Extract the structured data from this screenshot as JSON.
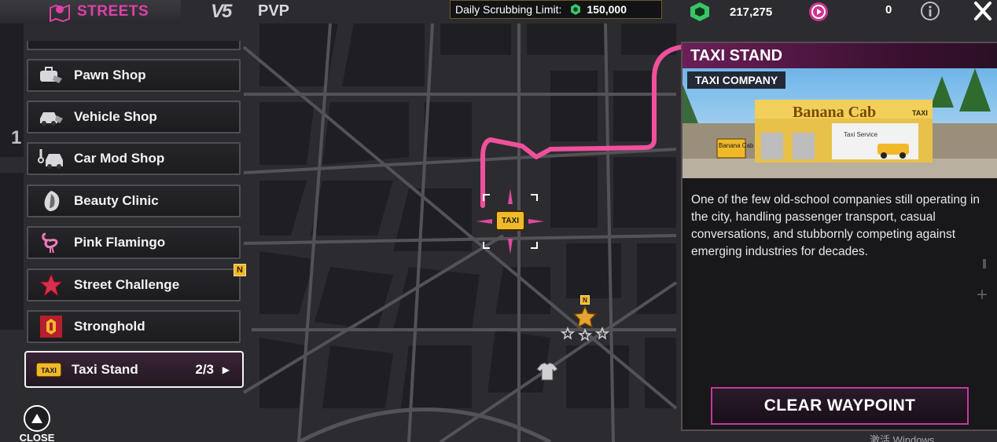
{
  "top_bar": {
    "streets_label": "STREETS",
    "vs_label": "V5",
    "pvp_label": "PVP",
    "limit_label": "Daily Scrubbing Limit:",
    "limit_value": "150,000",
    "currency_main": "217,275",
    "currency_secondary": "0"
  },
  "sidebar": {
    "items": [
      {
        "label": "Pawn Shop",
        "icon": "pawn-shop-icon"
      },
      {
        "label": "Vehicle Shop",
        "icon": "vehicle-shop-icon"
      },
      {
        "label": "Car Mod Shop",
        "icon": "car-mod-icon"
      },
      {
        "label": "Beauty Clinic",
        "icon": "beauty-clinic-icon"
      },
      {
        "label": "Pink Flamingo",
        "icon": "flamingo-icon"
      },
      {
        "label": "Street Challenge",
        "icon": "star-icon",
        "badge": "N"
      },
      {
        "label": "Stronghold",
        "icon": "stronghold-icon"
      },
      {
        "label": "Taxi Stand",
        "icon": "taxi-icon",
        "count": "2/3",
        "active": true
      }
    ],
    "left_marker": "1"
  },
  "close_label": "CLOSE",
  "detail": {
    "title": "TAXI STAND",
    "subtitle": "TAXI COMPANY",
    "sign_text": "Banana Cab",
    "sign_small": "Banana Cab",
    "sign_service": "Taxi Service",
    "sign_taxi": "TAXI",
    "description": "One of the few old-school companies still operating in the city, handling passenger transport, casual conversations, and stubbornly competing against emerging industries for decades.",
    "button_label": "CLEAR WAYPOINT"
  },
  "map": {
    "taxi_marker_label": "TAXI",
    "badge_label": "N"
  },
  "watermark": "激活 Windows",
  "colors": {
    "accent_pink": "#e0399f",
    "route_pink": "#f0509c",
    "gold": "#f1b92a"
  }
}
